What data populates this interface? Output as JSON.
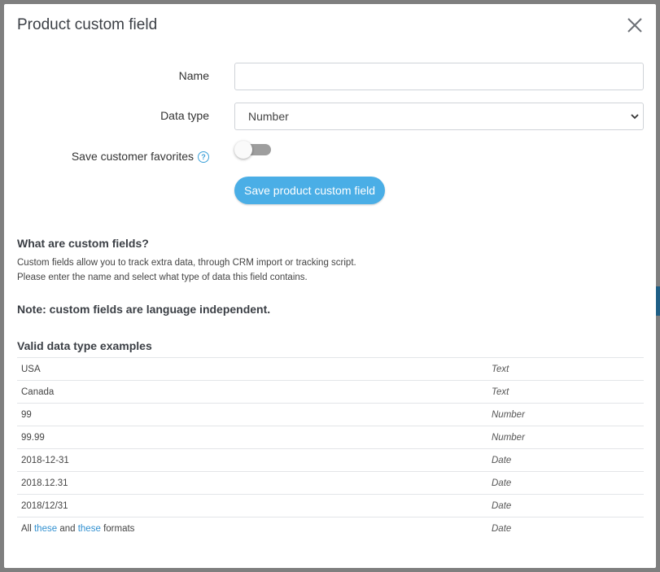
{
  "modal": {
    "title": "Product custom field",
    "close_icon": "close-icon"
  },
  "form": {
    "name_label": "Name",
    "name_value": "",
    "name_placeholder": "",
    "data_type_label": "Data type",
    "data_type_selected": "Number",
    "favorites_label": "Save customer favorites",
    "favorites_help_glyph": "?",
    "favorites_enabled": false,
    "save_label": "Save product custom field"
  },
  "info": {
    "heading": "What are custom fields?",
    "line1": "Custom fields allow you to track extra data, through CRM import or tracking script.",
    "line2": "Please enter the name and select what type of data this field contains.",
    "note": "Note: custom fields are language independent."
  },
  "examples": {
    "heading": "Valid data type examples",
    "rows": [
      {
        "example": "USA",
        "type": "Text"
      },
      {
        "example": "Canada",
        "type": "Text"
      },
      {
        "example": "99",
        "type": "Number"
      },
      {
        "example": "99.99",
        "type": "Number"
      },
      {
        "example": "2018-12-31",
        "type": "Date"
      },
      {
        "example": "2018.12.31",
        "type": "Date"
      },
      {
        "example": "2018/12/31",
        "type": "Date"
      }
    ],
    "last_row": {
      "prefix": "All",
      "link1": "these",
      "middle": "and",
      "link2": "these",
      "suffix": "formats",
      "type": "Date"
    }
  },
  "colors": {
    "accent": "#4aaee6",
    "link": "#2f8fd0",
    "toggle_off": "#9e9e9e"
  }
}
